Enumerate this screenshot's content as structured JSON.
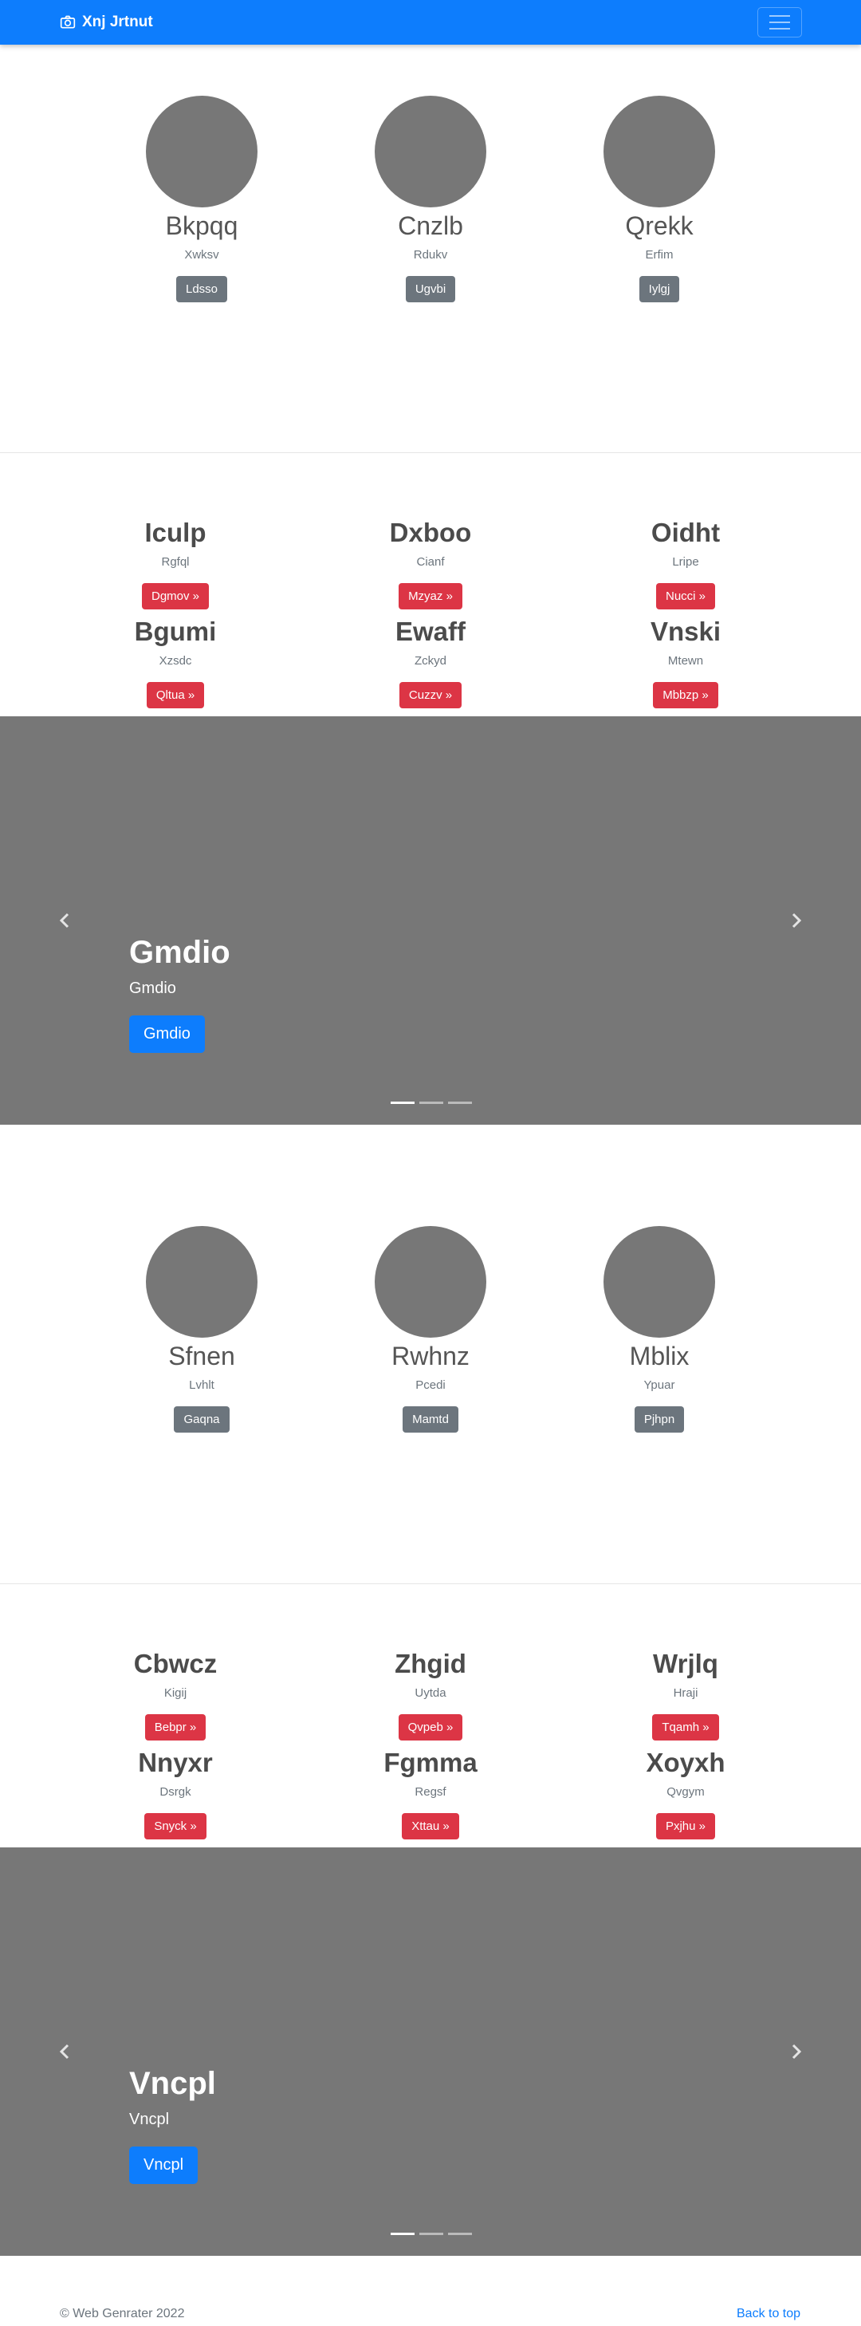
{
  "navbar": {
    "brand": "Xnj Jrtnut",
    "brand_icon": "camera-icon",
    "toggler_icon": "hamburger-icon",
    "color": "#0d7dfd"
  },
  "circles_1": [
    {
      "name": "Bkpqq",
      "sub": "Xwksv",
      "button": "Ldsso"
    },
    {
      "name": "Cnzlb",
      "sub": "Rdukv",
      "button": "Ugvbi"
    },
    {
      "name": "Qrekk",
      "sub": "Erfim",
      "button": "Iylgj"
    }
  ],
  "features_1": [
    {
      "title": "Iculp",
      "sub": "Rgfql",
      "button": "Dgmov »"
    },
    {
      "title": "Dxboo",
      "sub": "Cianf",
      "button": "Mzyaz »"
    },
    {
      "title": "Oidht",
      "sub": "Lripe",
      "button": "Nucci »"
    },
    {
      "title": "Bgumi",
      "sub": "Xzsdc",
      "button": "Qltua »"
    },
    {
      "title": "Ewaff",
      "sub": "Zckyd",
      "button": "Cuzzv »"
    },
    {
      "title": "Vnski",
      "sub": "Mtewn",
      "button": "Mbbzp »"
    }
  ],
  "carousel_1": {
    "title": "Gmdio",
    "sub": "Gmdio",
    "button": "Gmdio"
  },
  "circles_2": [
    {
      "name": "Sfnen",
      "sub": "Lvhlt",
      "button": "Gaqna"
    },
    {
      "name": "Rwhnz",
      "sub": "Pcedi",
      "button": "Mamtd"
    },
    {
      "name": "Mblix",
      "sub": "Ypuar",
      "button": "Pjhpn"
    }
  ],
  "features_2": [
    {
      "title": "Cbwcz",
      "sub": "Kigij",
      "button": "Bebpr »"
    },
    {
      "title": "Zhgid",
      "sub": "Uytda",
      "button": "Qvpeb »"
    },
    {
      "title": "Wrjlq",
      "sub": "Hraji",
      "button": "Tqamh »"
    },
    {
      "title": "Nnyxr",
      "sub": "Dsrgk",
      "button": "Snyck »"
    },
    {
      "title": "Fgmma",
      "sub": "Regsf",
      "button": "Xttau »"
    },
    {
      "title": "Xoyxh",
      "sub": "Qvgym",
      "button": "Pxjhu »"
    }
  ],
  "carousel_2": {
    "title": "Vncpl",
    "sub": "Vncpl",
    "button": "Vncpl"
  },
  "footer": {
    "copyright": "© Web Genrater 2022",
    "back_to_top": "Back to top"
  }
}
